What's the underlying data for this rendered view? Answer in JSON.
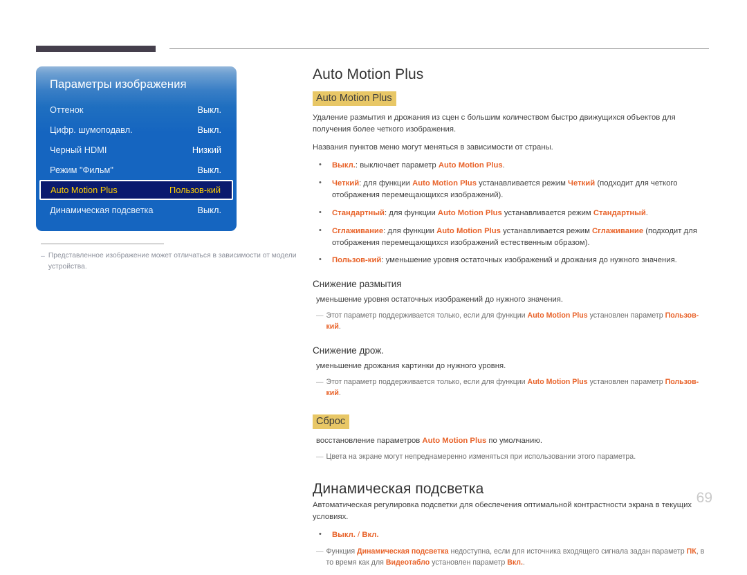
{
  "osd": {
    "title": "Параметры изображения",
    "rows": [
      {
        "label": "Оттенок",
        "value": "Выкл."
      },
      {
        "label": "Цифр. шумоподавл.",
        "value": "Выкл."
      },
      {
        "label": "Черный HDMI",
        "value": "Низкий"
      },
      {
        "label": "Режим \"Фильм\"",
        "value": "Выкл."
      },
      {
        "label": "Auto Motion Plus",
        "value": "Пользов-кий"
      },
      {
        "label": "Динамическая подсветка",
        "value": "Выкл."
      }
    ],
    "footnote": {
      "dash": "–",
      "text": "Представленное изображение может отличаться в зависимости от модели устройства."
    }
  },
  "content": {
    "h1_primary": "Auto Motion Plus",
    "highlight_1": "Auto Motion Plus",
    "intro_1": "Удаление размытия и дрожания из сцен с большим количеством быстро движущихся объектов для получения более четкого изображения.",
    "intro_2": "Названия пунктов меню могут меняться в зависимости от страны.",
    "bullets": [
      {
        "term": "Выкл.",
        "after_term": ": выключает параметр ",
        "emph": "Auto Motion Plus",
        "tail": "."
      },
      {
        "term": "Четкий",
        "after_term": ": для функции ",
        "emph": "Auto Motion Plus",
        "mid": " устанавливается режим ",
        "emph2": "Четкий",
        "tail": " (подходит для четкого отображения перемещающихся изображений)."
      },
      {
        "term": "Стандартный",
        "after_term": ": для функции ",
        "emph": "Auto Motion Plus",
        "mid": " устанавливается режим ",
        "emph2": "Стандартный",
        "tail": "."
      },
      {
        "term": "Сглаживание",
        "after_term": ": для функции ",
        "emph": "Auto Motion Plus",
        "mid": " устанавливается режим ",
        "emph2": "Сглаживание",
        "tail": " (подходит для отображения перемещающихся изображений естественным образом)."
      },
      {
        "term": "Пользов-кий",
        "after_term": ": уменьшение уровня остаточных изображений и дрожания до нужного значения.",
        "emph": "",
        "tail": ""
      }
    ],
    "section_blur": {
      "heading": "Снижение размытия",
      "body": "уменьшение уровня остаточных изображений до нужного значения.",
      "note_dash": "—",
      "note_a": "Этот параметр поддерживается только, если для функции ",
      "note_emph": "Auto Motion Plus",
      "note_b": " установлен параметр ",
      "note_emph2": "Пользов-кий",
      "note_c": "."
    },
    "section_judder": {
      "heading": "Снижение дрож.",
      "body": "уменьшение дрожания картинки до нужного уровня.",
      "note_dash": "—",
      "note_a": "Этот параметр поддерживается только, если для функции ",
      "note_emph": "Auto Motion Plus",
      "note_b": " установлен параметр ",
      "note_emph2": "Пользов-кий",
      "note_c": "."
    },
    "section_reset": {
      "highlight": "Сброс",
      "body_a": "восстановление параметров ",
      "body_emph": "Auto Motion Plus",
      "body_b": " по умолчанию.",
      "note_dash": "—",
      "note": "Цвета на экране могут непреднамеренно изменяться при использовании этого параметра."
    },
    "h1_secondary": "Динамическая подсветка",
    "dyn_intro": "Автоматическая регулировка подсветки для обеспечения оптимальной контрастности экрана в текущих условиях.",
    "dyn_bullet_off": "Выкл.",
    "dyn_bullet_sep": " / ",
    "dyn_bullet_on": "Вкл.",
    "dyn_note": {
      "dash": "—",
      "a": "Функция ",
      "emph1": "Динамическая подсветка",
      "b": " недоступна, если для источника входящего сигнала задан параметр ",
      "emph2": "ПК",
      "c": ", в то время как для ",
      "emph3": "Видеотабло",
      "d": " установлен параметр ",
      "emph4": "Вкл.",
      "e": "."
    }
  },
  "page_number": "69"
}
